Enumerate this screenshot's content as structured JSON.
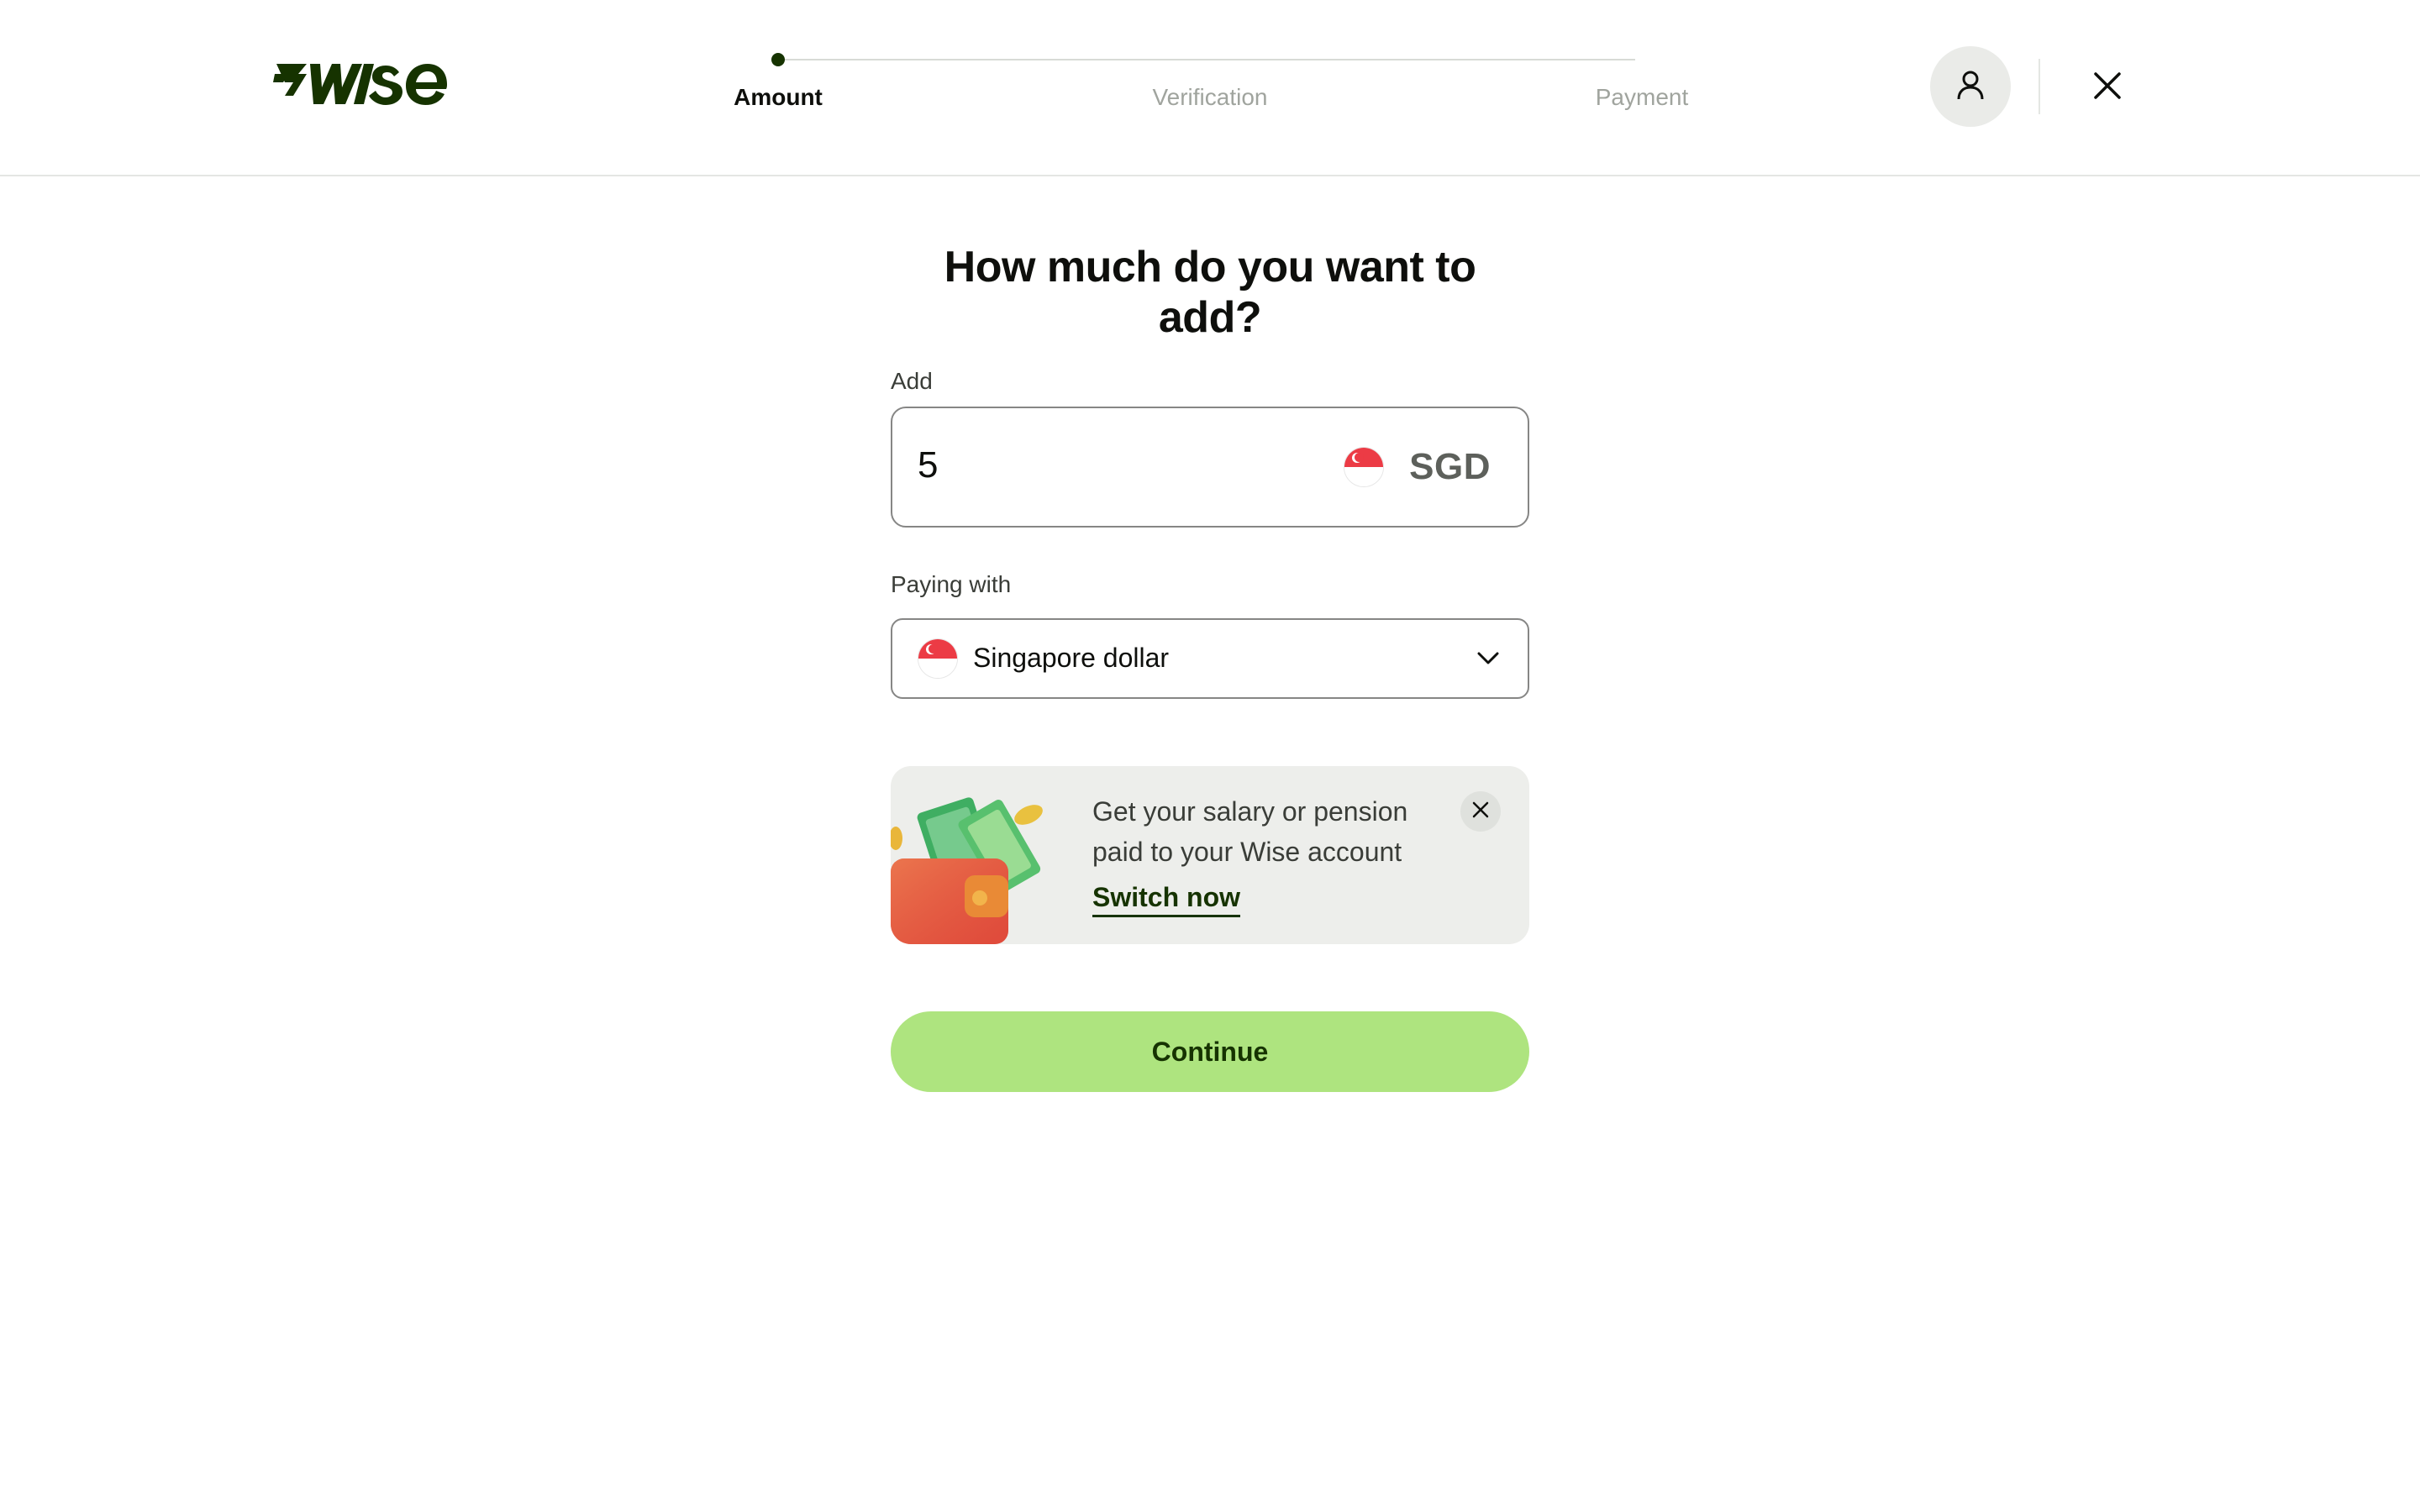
{
  "header": {
    "logo_text": "7WISE",
    "steps": [
      {
        "label": "Amount",
        "active": true
      },
      {
        "label": "Verification",
        "active": false
      },
      {
        "label": "Payment",
        "active": false
      }
    ],
    "icons": {
      "account": "user-icon",
      "close": "close-icon"
    }
  },
  "main": {
    "title": "How much do you want to add?",
    "add": {
      "label": "Add",
      "value": "5",
      "currency_code": "SGD",
      "flag": "singapore-flag-icon"
    },
    "paying_with": {
      "label": "Paying with",
      "selected": "Singapore dollar",
      "flag": "singapore-flag-icon"
    },
    "promo": {
      "text": "Get your salary or pension paid to your Wise account",
      "link": "Switch now",
      "image": "wallet-with-money-illustration"
    },
    "continue_label": "Continue"
  },
  "colors": {
    "brand_dark": "#163300",
    "accent_green": "#aee47f",
    "flag_red": "#ec3b45",
    "muted_text": "#a0a49e"
  }
}
